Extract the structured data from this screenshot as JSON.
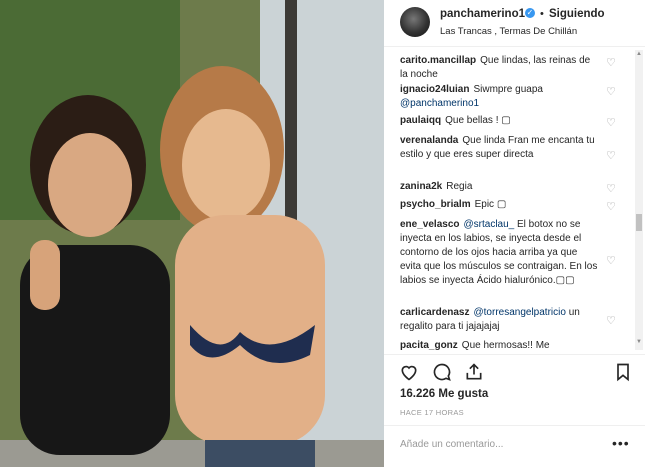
{
  "post": {
    "username": "panchamerino1",
    "separator": "•",
    "follow_status": "Siguiendo",
    "location": "Las Trancas , Termas De Chillán",
    "verified_glyph": "✓"
  },
  "comments": [
    {
      "user": "carito.mancillap",
      "text": "Que lindas, las reinas de la noche"
    },
    {
      "user": "ignacio24luian",
      "text": "Siwmpre guapa ",
      "mention": "@panchamerino1"
    },
    {
      "user": "paulaiqq",
      "text": "Que bellas ! ▢"
    },
    {
      "user": "verenalanda",
      "text": "Que linda Fran me encanta tu estilo y que eres super directa"
    },
    {
      "user": "zanina2k",
      "text": "Regia"
    },
    {
      "user": "psycho_brialm",
      "text": "Epic ▢"
    },
    {
      "user": "ene_velasco",
      "mention": "@srtaclau_",
      "text": " El botox no se inyecta en los labios, se inyecta desde el contorno de los ojos hacia arriba ya que evita que los músculos se contraigan. En los labios se inyecta Ácido hialurónico.▢▢"
    },
    {
      "user": "carlicardenasz",
      "mention": "@torresangelpatricio",
      "text": " un regalito para ti jajajajaj"
    },
    {
      "user": "pacita_gonz",
      "text": "Que hermosas!! Me"
    }
  ],
  "likes": "16.226 Me gusta",
  "time_ago": "HACE 17 HORAS",
  "comment_placeholder": "Añade un comentario...",
  "more_glyph": "•••",
  "heart_glyph": "♡",
  "scroll_up_glyph": "▲",
  "scroll_down_glyph": "▼",
  "colors": {
    "link": "#003569",
    "verified": "#3897f0",
    "muted": "#999999"
  }
}
